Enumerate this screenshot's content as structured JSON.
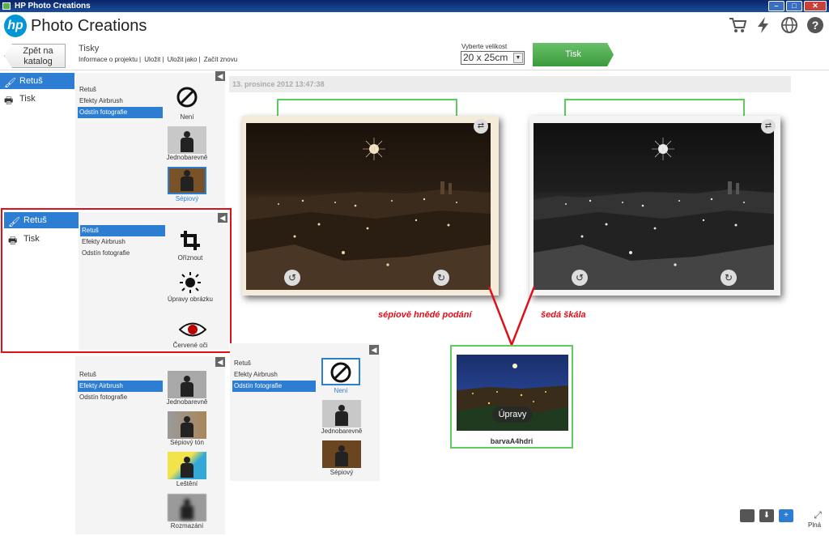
{
  "window": {
    "title": "HP Photo Creations"
  },
  "header": {
    "logo_text": "hp",
    "app_title": "Photo Creations",
    "icons": [
      "cart-icon",
      "lightning-icon",
      "globe-icon",
      "help-icon"
    ]
  },
  "toolbar": {
    "back_label_line1": "Zpět na",
    "back_label_line2": "katalog",
    "section_title": "Tisky",
    "links": [
      "Informace o projektu",
      "Uložit",
      "Uložit jako",
      "Začít znovu"
    ],
    "separator": "|",
    "size_label": "Vyberte velikost",
    "size_value": "20 x 25cm",
    "print_label": "Tisk"
  },
  "nav": {
    "retouch": "Retuš",
    "print": "Tisk"
  },
  "panel_top": {
    "sub": [
      "Retuš",
      "Efekty Airbrush",
      "Odstín fotografie"
    ],
    "selected_sub": 2,
    "options": [
      "Není",
      "Jednobarevně",
      "Sépiový"
    ],
    "selected_option": 2
  },
  "panel_highlight": {
    "sub": [
      "Retuš",
      "Efekty Airbrush",
      "Odstín fotografie"
    ],
    "selected_sub": 0,
    "tools": [
      "Oříznout",
      "Úpravy obrázku",
      "Červené oči"
    ]
  },
  "panel_airbrush": {
    "sub": [
      "Retuš",
      "Efekty Airbrush",
      "Odstín fotografie"
    ],
    "selected_sub": 1,
    "effects": [
      "Jednobarevně",
      "Sépiový tón",
      "Leštění",
      "Rozmazání"
    ]
  },
  "panel_tone": {
    "sub": [
      "Retuš",
      "Efekty Airbrush",
      "Odstín fotografie"
    ],
    "selected_sub": 2,
    "options": [
      "Není",
      "Jednobarevně",
      "Sépiový"
    ],
    "selected_option": 0
  },
  "canvas": {
    "date": "13. prosince 2012 13:47:38",
    "annotation_sepia": "sépiově hnědé podání",
    "annotation_gray": "šedá škála",
    "edit_label": "Úpravy",
    "source_name": "barvaA4hdri"
  },
  "footer": {
    "full_label": "Plná"
  },
  "colors": {
    "accent": "#2d7dd2",
    "print_green": "#4caf50",
    "frame_green": "#5ccc5c",
    "annotation_red": "#e0101a"
  }
}
